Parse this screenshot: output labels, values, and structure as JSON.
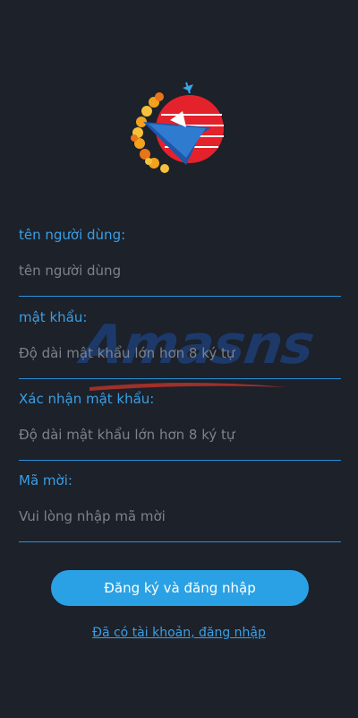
{
  "brand": {
    "watermark_text": "Amasns"
  },
  "form": {
    "username": {
      "label": "tên người dùng:",
      "placeholder": "tên người dùng"
    },
    "password": {
      "label": "mật khẩu:",
      "placeholder": "Độ dài mật khẩu lớn hơn 8 ký tự"
    },
    "confirm_password": {
      "label": "Xác nhận mật khẩu:",
      "placeholder": "Độ dài mật khẩu lớn hơn 8 ký tự"
    },
    "invite_code": {
      "label": "Mã mời:",
      "placeholder": "Vui lòng nhập mã mời"
    },
    "submit_label": "Đăng ký và đăng nhập",
    "login_link": "Đã có tài khoản, đăng nhập"
  },
  "colors": {
    "background": "#1c212a",
    "accent": "#2aa1e4",
    "label": "#3b9ee4",
    "placeholder": "#7d828b"
  }
}
